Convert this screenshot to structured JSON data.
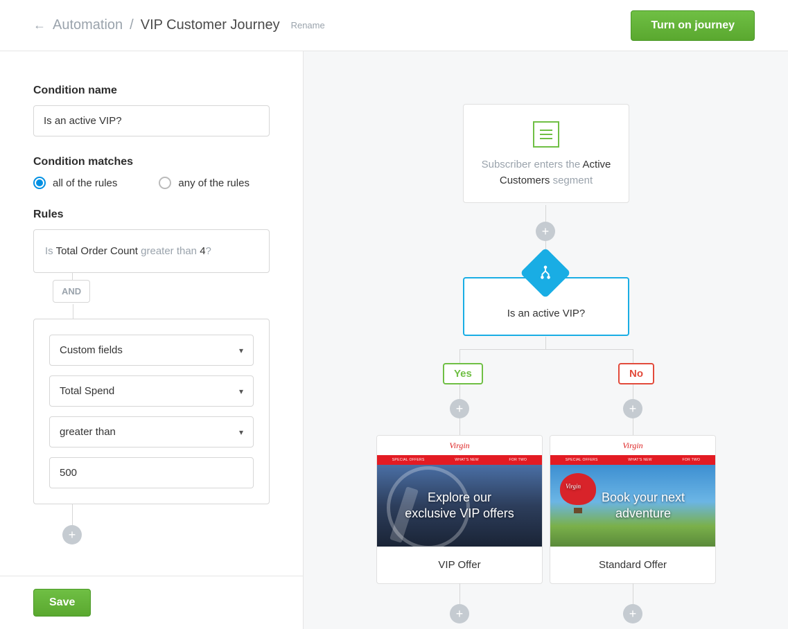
{
  "header": {
    "breadcrumb_root": "Automation",
    "breadcrumb_current": "VIP Customer Journey",
    "rename": "Rename",
    "turn_on": "Turn on journey"
  },
  "sidebar": {
    "condition_name_label": "Condition name",
    "condition_name_value": "Is an active VIP?",
    "matches_label": "Condition matches",
    "radio_all": "all of the rules",
    "radio_any": "any of the rules",
    "rules_label": "Rules",
    "rule_summary": {
      "prefix": "Is ",
      "field": "Total Order Count",
      "op": " greater than ",
      "value": "4",
      "suffix": "?"
    },
    "and_label": "AND",
    "editor": {
      "field_type": "Custom fields",
      "field_name": "Total Spend",
      "operator": "greater than",
      "value": "500"
    },
    "save": "Save"
  },
  "canvas": {
    "trigger": {
      "pre": "Subscriber enters the ",
      "segment": "Active Customers",
      "post": " segment"
    },
    "condition_label": "Is an active VIP?",
    "branch_yes": "Yes",
    "branch_no": "No",
    "email_yes": {
      "title": "VIP Offer",
      "hero_line1": "Explore our",
      "hero_line2": "exclusive VIP offers",
      "nav1": "SPECIAL OFFERS",
      "nav2": "WHAT'S NEW",
      "nav3": "FOR TWO"
    },
    "email_no": {
      "title": "Standard Offer",
      "hero_line1": "Book your next",
      "hero_line2": "adventure",
      "nav1": "SPECIAL OFFERS",
      "nav2": "WHAT'S NEW",
      "nav3": "FOR TWO"
    }
  }
}
